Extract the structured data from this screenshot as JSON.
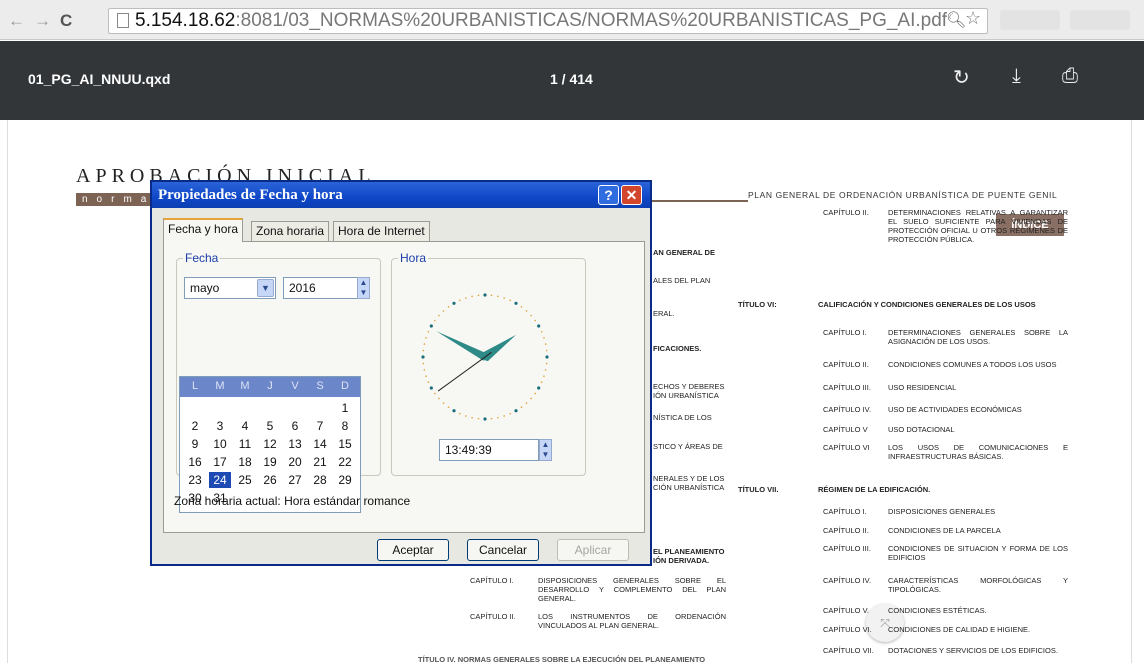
{
  "browser": {
    "url_host": "5.154.18.62",
    "url_rest": ":8081/03_NORMAS%20URBANISTICAS/NORMAS%20URBANISTICAS_PG_AI.pdf"
  },
  "toolbar": {
    "filename": "01_PG_AI_NNUU.qxd",
    "page_indicator": "1 / 414"
  },
  "pdf": {
    "title": "APROBACIÓN INICIAL",
    "subtitle": "normas",
    "plan_header": "PLAN GENERAL DE ORDENACIÓN URBANÍSTICA DE PUENTE GENIL",
    "indice": "ÍNDICE",
    "left_fragments": [
      "AN GENERAL DE",
      "ALES DEL PLAN",
      "ERAL.",
      "FICACIONES.",
      "ECHOS Y DEBERES",
      "IÓN URBANÍSTICA",
      "NÍSTICA DE LOS",
      "STICO Y ÁREAS DE",
      "NERALES Y DE LOS",
      "CIÓN URBANÍSTICA",
      "EL PLANEAMIENTO",
      "IÓN DERIVADA."
    ],
    "bottom_left": [
      {
        "label": "CAPÍTULO I.",
        "text": "DISPOSICIONES GENERALES SOBRE EL DESARROLLO Y COMPLEMENTO DEL PLAN GENERAL."
      },
      {
        "label": "CAPÍTULO II.",
        "text": "LOS INSTRUMENTOS DE ORDENACIÓN VINCULADOS AL PLAN GENERAL."
      }
    ],
    "right_rows": [
      {
        "label": "CAPÍTULO II.",
        "text": "DETERMINACIONES RELATIVAS A GARANTIZAR EL SUELO SUFICIENTE PARA VIVIENDAS DE PROTECCIÓN OFICIAL U OTROS REGÍMENES DE PROTECCIÓN PÚBLICA."
      },
      {
        "label": "TÍTULO VI:",
        "text": "CALIFICACIÓN Y CONDICIONES GENERALES DE LOS USOS"
      },
      {
        "label": "CAPÍTULO I.",
        "text": "DETERMINACIONES GENERALES SOBRE LA ASIGNACIÓN DE LOS USOS."
      },
      {
        "label": "CAPÍTULO II.",
        "text": "CONDICIONES COMUNES A TODOS LOS USOS"
      },
      {
        "label": "CAPÍTULO III.",
        "text": "USO RESIDENCIAL"
      },
      {
        "label": "CAPÍTULO IV.",
        "text": "USO DE ACTIVIDADES ECONÓMICAS"
      },
      {
        "label": "CAPÍTULO V",
        "text": "USO DOTACIONAL"
      },
      {
        "label": "CAPÍTULO VI",
        "text": "LOS USOS DE COMUNICACIONES E INFRAESTRUCTURAS BÁSICAS."
      },
      {
        "label": "TÍTULO VII.",
        "text": "RÉGIMEN DE LA EDIFICACIÓN."
      },
      {
        "label": "CAPÍTULO I.",
        "text": "DISPOSICIONES GENERALES"
      },
      {
        "label": "CAPÍTULO II.",
        "text": "CONDICIONES DE LA PARCELA"
      },
      {
        "label": "CAPÍTULO III.",
        "text": "CONDICIONES DE SITUACION Y FORMA DE LOS EDIFICIOS"
      },
      {
        "label": "CAPÍTULO IV.",
        "text": "CARACTERÍSTICAS MORFOLÓGICAS Y TIPOLÓGICAS."
      },
      {
        "label": "CAPÍTULO V.",
        "text": "CONDICIONES ESTÉTICAS."
      },
      {
        "label": "CAPÍTULO VI.",
        "text": "CONDICIONES DE CALIDAD E HIGIENE."
      },
      {
        "label": "CAPÍTULO VII.",
        "text": "DOTACIONES Y SERVICIOS DE LOS EDIFICIOS."
      }
    ],
    "cut_footer": "TÍTULO IV.   NORMAS GENERALES SOBRE LA EJECUCIÓN DEL PLANEAMIENTO"
  },
  "dialog": {
    "title": "Propiedades de Fecha y hora",
    "help": "?",
    "close": "✕",
    "tabs": [
      "Fecha y hora",
      "Zona horaria",
      "Hora de Internet"
    ],
    "fecha_group": "Fecha",
    "month": "mayo",
    "year": "2016",
    "weekdays": [
      "L",
      "M",
      "M",
      "J",
      "V",
      "S",
      "D"
    ],
    "days": [
      "1",
      "2",
      "3",
      "4",
      "5",
      "6",
      "7",
      "8",
      "9",
      "10",
      "11",
      "12",
      "13",
      "14",
      "15",
      "16",
      "17",
      "18",
      "19",
      "20",
      "21",
      "22",
      "23",
      "24",
      "25",
      "26",
      "27",
      "28",
      "29",
      "30",
      "31"
    ],
    "selected_day": 24,
    "hora_group": "Hora",
    "time": "13:49:39",
    "timezone": "Zona horaria actual: Hora estándar romance",
    "buttons": {
      "ok": "Aceptar",
      "cancel": "Cancelar",
      "apply": "Aplicar"
    }
  },
  "colors": {
    "title_bar": "#0f47c8",
    "accent": "#7d6354",
    "calendar_header": "#6b86c9",
    "selected_day": "#1e4bb3",
    "clock_hands": "#2e8a86"
  },
  "icons": [
    "back-arrow-icon",
    "forward-arrow-icon",
    "reload-icon",
    "document-icon",
    "zoom-icon",
    "star-icon",
    "rotate-icon",
    "download-icon",
    "print-icon",
    "fit-page-icon"
  ]
}
